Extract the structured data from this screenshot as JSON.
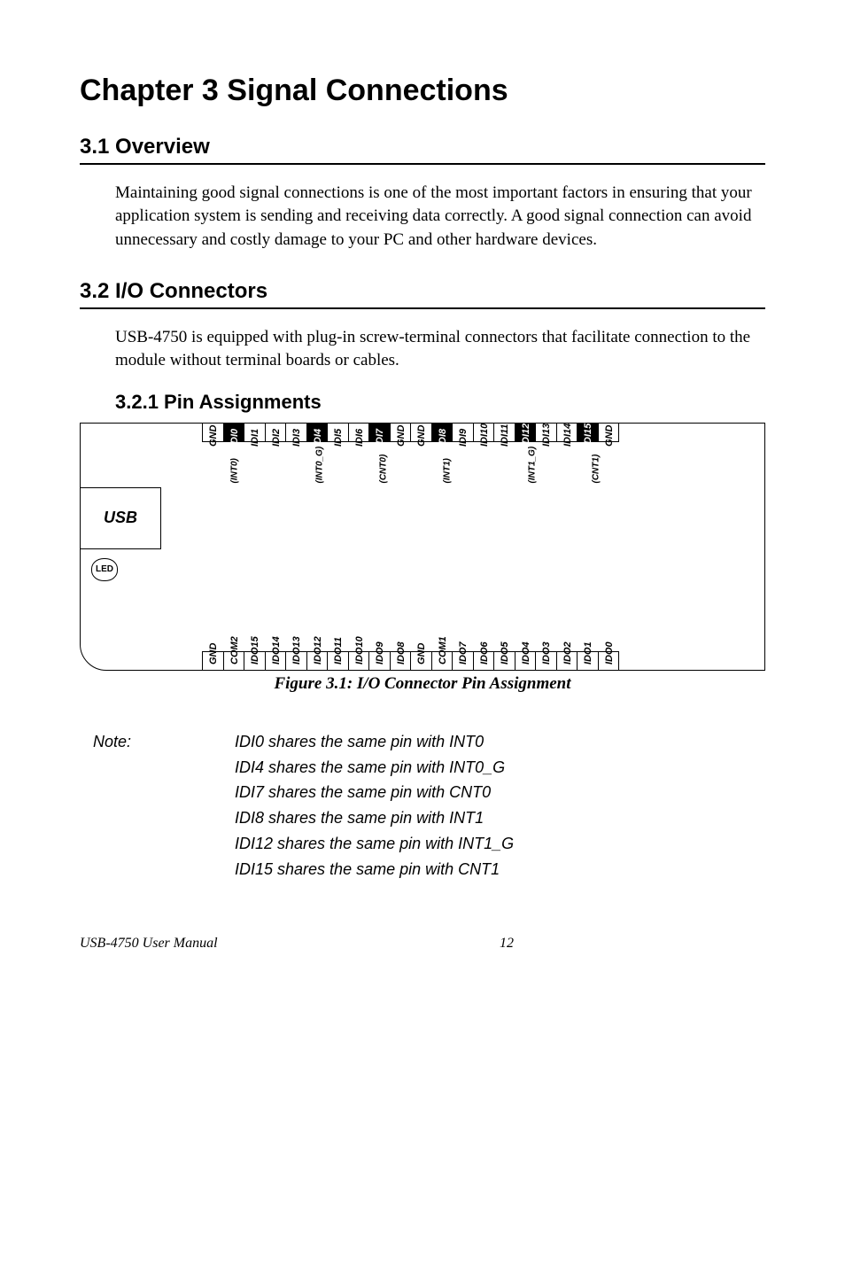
{
  "chapter": {
    "title": "Chapter 3  Signal Connections"
  },
  "section31": {
    "heading": "3.1  Overview",
    "body": "Maintaining good signal connections is one of the most important factors in ensuring that your application system is sending and receiving data correctly. A good signal connection can avoid unnecessary and costly damage to your PC and other hardware devices."
  },
  "section32": {
    "heading": "3.2  I/O Connectors",
    "body": "USB-4750 is equipped with plug-in screw-terminal connectors that facilitate connection to the module without terminal boards or cables."
  },
  "section321": {
    "heading": "3.2.1 Pin Assignments"
  },
  "diagram": {
    "usb_label": "USB",
    "led_label": "LED",
    "top_terminals": [
      {
        "label": "GND",
        "black": false
      },
      {
        "label": "IDI0",
        "black": true
      },
      {
        "label": "IDI1",
        "black": false
      },
      {
        "label": "IDI2",
        "black": false
      },
      {
        "label": "IDI3",
        "black": false
      },
      {
        "label": "IDI4",
        "black": true
      },
      {
        "label": "IDI5",
        "black": false
      },
      {
        "label": "IDI6",
        "black": false
      },
      {
        "label": "IDI7",
        "black": true
      },
      {
        "label": "GND",
        "black": false
      },
      {
        "label": "GND",
        "black": false
      },
      {
        "label": "IDI8",
        "black": true
      },
      {
        "label": "IDI9",
        "black": false
      },
      {
        "label": "IDI10",
        "black": false
      },
      {
        "label": "IDI11",
        "black": false
      },
      {
        "label": "IDI12",
        "black": true
      },
      {
        "label": "IDI13",
        "black": false
      },
      {
        "label": "IDI14",
        "black": false
      },
      {
        "label": "IDI15",
        "black": true
      },
      {
        "label": "GND",
        "black": false
      }
    ],
    "top_brackets": [
      {
        "pos": 1,
        "label": "(INT0)"
      },
      {
        "pos": 5,
        "label": "(INT0_G)"
      },
      {
        "pos": 8,
        "label": "(CNT0)"
      },
      {
        "pos": 11,
        "label": "(INT1)"
      },
      {
        "pos": 15,
        "label": "(INT1_G)"
      },
      {
        "pos": 18,
        "label": "(CNT1)"
      }
    ],
    "bottom_terminals": [
      {
        "label": "GND"
      },
      {
        "label": "COM2"
      },
      {
        "label": "IDO15"
      },
      {
        "label": "IDO14"
      },
      {
        "label": "IDO13"
      },
      {
        "label": "IDO12"
      },
      {
        "label": "IDO11"
      },
      {
        "label": "IDO10"
      },
      {
        "label": "IDO9"
      },
      {
        "label": "IDO8"
      },
      {
        "label": "GND"
      },
      {
        "label": "COM1"
      },
      {
        "label": "IDO7"
      },
      {
        "label": "IDO6"
      },
      {
        "label": "IDO5"
      },
      {
        "label": "IDO4"
      },
      {
        "label": "IDO3"
      },
      {
        "label": "IDO2"
      },
      {
        "label": "IDO1"
      },
      {
        "label": "IDO0"
      }
    ]
  },
  "figure_caption": "Figure 3.1: I/O Connector Pin Assignment",
  "note": {
    "label": "Note:",
    "lines": [
      "IDI0 shares the same pin with INT0",
      "IDI4 shares the same pin with INT0_G",
      "IDI7 shares the same pin with CNT0",
      "IDI8 shares the same pin with INT1",
      "IDI12 shares the same pin with INT1_G",
      "IDI15 shares the same pin with CNT1"
    ]
  },
  "footer": {
    "title": "USB-4750 User Manual",
    "page": "12"
  }
}
